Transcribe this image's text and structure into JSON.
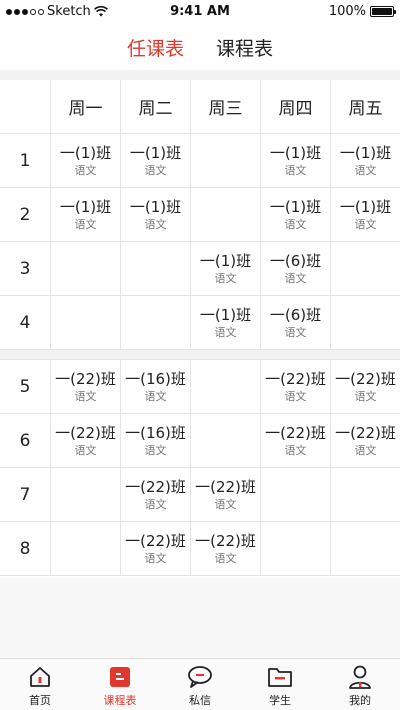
{
  "status_bar": {
    "carrier": "Sketch",
    "time": "9:41 AM",
    "battery": "100%"
  },
  "tabs": [
    {
      "label": "任课表",
      "active": true
    },
    {
      "label": "课程表",
      "active": false
    }
  ],
  "timetable": {
    "days": [
      "周一",
      "周二",
      "周三",
      "周四",
      "周五"
    ],
    "periods": [
      {
        "label": "1",
        "cells": [
          {
            "cls": "一(1)班",
            "subj": "语文"
          },
          {
            "cls": "一(1)班",
            "subj": "语文"
          },
          null,
          {
            "cls": "一(1)班",
            "subj": "语文"
          },
          {
            "cls": "一(1)班",
            "subj": "语文"
          }
        ]
      },
      {
        "label": "2",
        "cells": [
          {
            "cls": "一(1)班",
            "subj": "语文"
          },
          {
            "cls": "一(1)班",
            "subj": "语文"
          },
          null,
          {
            "cls": "一(1)班",
            "subj": "语文"
          },
          {
            "cls": "一(1)班",
            "subj": "语文"
          }
        ]
      },
      {
        "label": "3",
        "cells": [
          null,
          null,
          {
            "cls": "一(1)班",
            "subj": "语文"
          },
          {
            "cls": "一(6)班",
            "subj": "语文"
          },
          null
        ]
      },
      {
        "label": "4",
        "cells": [
          null,
          null,
          {
            "cls": "一(1)班",
            "subj": "语文"
          },
          {
            "cls": "一(6)班",
            "subj": "语文"
          },
          null
        ]
      },
      {
        "label": "5",
        "cells": [
          {
            "cls": "一(22)班",
            "subj": "语文"
          },
          {
            "cls": "一(16)班",
            "subj": "语文"
          },
          null,
          {
            "cls": "一(22)班",
            "subj": "语文"
          },
          {
            "cls": "一(22)班",
            "subj": "语文"
          }
        ]
      },
      {
        "label": "6",
        "cells": [
          {
            "cls": "一(22)班",
            "subj": "语文"
          },
          {
            "cls": "一(16)班",
            "subj": "语文"
          },
          null,
          {
            "cls": "一(22)班",
            "subj": "语文"
          },
          {
            "cls": "一(22)班",
            "subj": "语文"
          }
        ]
      },
      {
        "label": "7",
        "cells": [
          null,
          {
            "cls": "一(22)班",
            "subj": "语文"
          },
          {
            "cls": "一(22)班",
            "subj": "语文"
          },
          null,
          null
        ]
      },
      {
        "label": "8",
        "cells": [
          null,
          {
            "cls": "一(22)班",
            "subj": "语文"
          },
          {
            "cls": "一(22)班",
            "subj": "语文"
          },
          null,
          null
        ]
      }
    ]
  },
  "bottom_nav": [
    {
      "label": "首页",
      "icon": "home-icon",
      "active": false
    },
    {
      "label": "课程表",
      "icon": "schedule-icon",
      "active": true
    },
    {
      "label": "私信",
      "icon": "message-icon",
      "active": false
    },
    {
      "label": "学生",
      "icon": "folder-icon",
      "active": false
    },
    {
      "label": "我的",
      "icon": "profile-icon",
      "active": false
    }
  ],
  "colors": {
    "accent": "#e0382d",
    "divider": "#e4e4e4",
    "section_bg": "#f2f2f2"
  }
}
